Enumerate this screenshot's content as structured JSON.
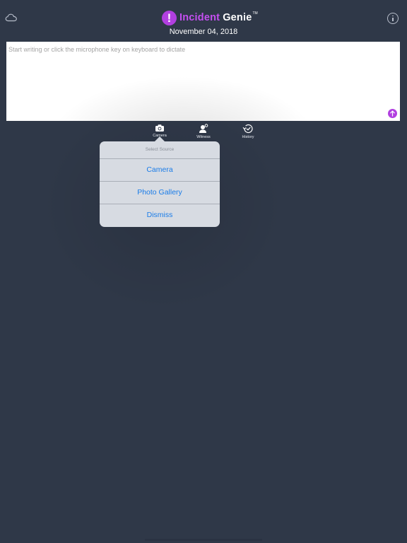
{
  "header": {
    "app_name_part1": "Incident",
    "app_name_part2": "Genie",
    "trademark": "TM",
    "logo_mark": "!",
    "date": "November 04, 2018",
    "left_icon": "cloud-icon",
    "right_icon": "info-icon"
  },
  "editor": {
    "placeholder": "Start writing or click the microphone key on keyboard to dictate",
    "send_icon": "arrow-up-icon"
  },
  "toolbar": {
    "items": [
      {
        "label": "Camera",
        "icon": "camera-icon"
      },
      {
        "label": "Witness",
        "icon": "witness-icon"
      },
      {
        "label": "History",
        "icon": "history-icon"
      }
    ]
  },
  "popover": {
    "title": "Select Source",
    "items": [
      "Camera",
      "Photo Gallery",
      "Dismiss"
    ]
  },
  "colors": {
    "background": "#2f3848",
    "accent": "#b13fe0",
    "link": "#1a7ce8"
  }
}
